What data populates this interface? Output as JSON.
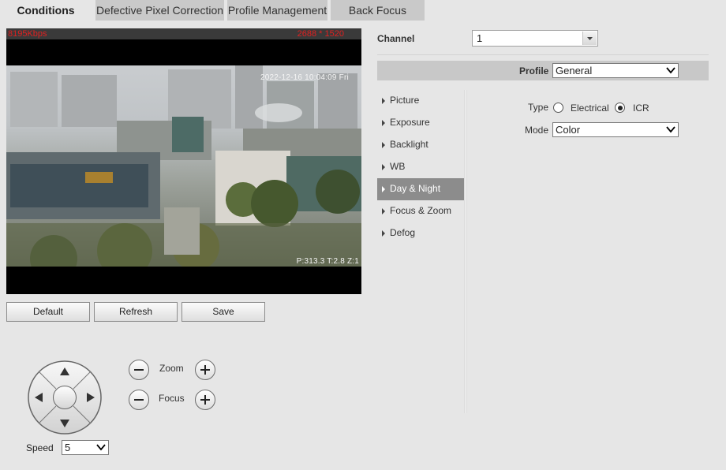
{
  "tabs": [
    {
      "label": "Conditions",
      "active": true
    },
    {
      "label": "Defective Pixel Correction",
      "active": false
    },
    {
      "label": "Profile Management",
      "active": false
    },
    {
      "label": "Back Focus",
      "active": false
    }
  ],
  "video": {
    "bitrate": "8195Kbps",
    "resolution": "2688 * 1520",
    "timestamp": "2022-12-16 10:04:09 Fri",
    "ptz_readout": "P:313.3 T:2.8 Z:1"
  },
  "buttons": {
    "default": "Default",
    "refresh": "Refresh",
    "save": "Save"
  },
  "ptz": {
    "zoom_label": "Zoom",
    "focus_label": "Focus",
    "speed_label": "Speed",
    "speed_value": "5"
  },
  "settings": {
    "channel_label": "Channel",
    "channel_value": "1",
    "profile_label": "Profile",
    "profile_value": "General",
    "menu": [
      "Picture",
      "Exposure",
      "Backlight",
      "WB",
      "Day & Night",
      "Focus & Zoom",
      "Defog"
    ],
    "active_menu": "Day & Night",
    "type_label": "Type",
    "type_options": [
      "Electrical",
      "ICR"
    ],
    "type_selected": "ICR",
    "mode_label": "Mode",
    "mode_value": "Color"
  },
  "colors": {
    "background": "#e6e6e6",
    "tab_inactive": "#c9c9c9",
    "menu_active": "#8c8c8c",
    "osd_red": "#e02020"
  }
}
